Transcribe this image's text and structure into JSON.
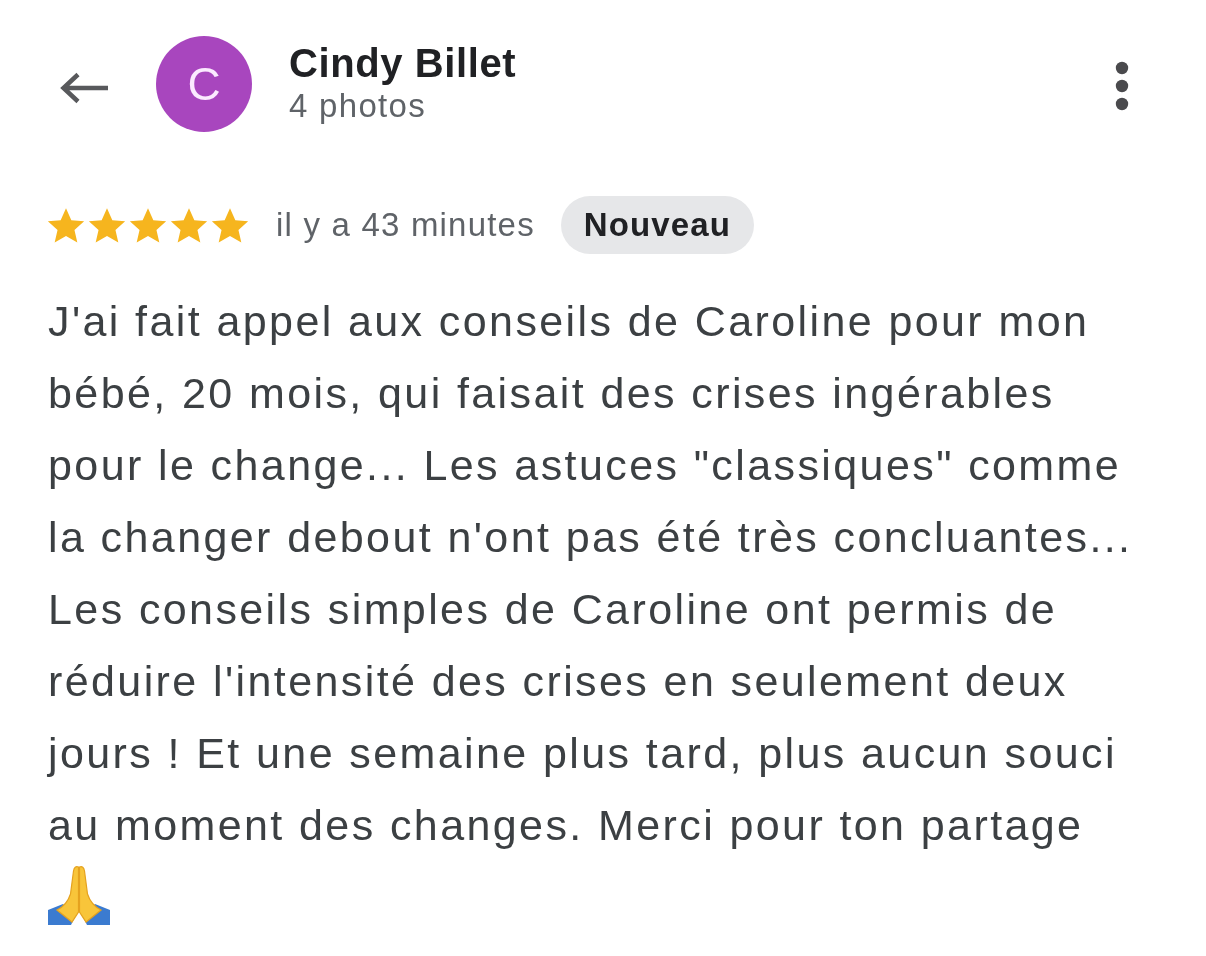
{
  "header": {
    "avatar_initial": "C",
    "name": "Cindy Billet",
    "subtitle": "4 photos"
  },
  "review": {
    "stars": 5,
    "time": "il y a 43 minutes",
    "badge": "Nouveau",
    "text": "J'ai fait appel aux conseils de Caroline pour mon bébé, 20 mois, qui faisait des crises ingérables pour le change... Les astuces \"classiques\" comme la changer debout n'ont pas été très concluantes... Les conseils simples de Caroline ont permis de réduire l'intensité des crises en seulement deux jours ! Et une semaine plus tard, plus aucun souci au moment des changes. Merci pour ton partage"
  }
}
